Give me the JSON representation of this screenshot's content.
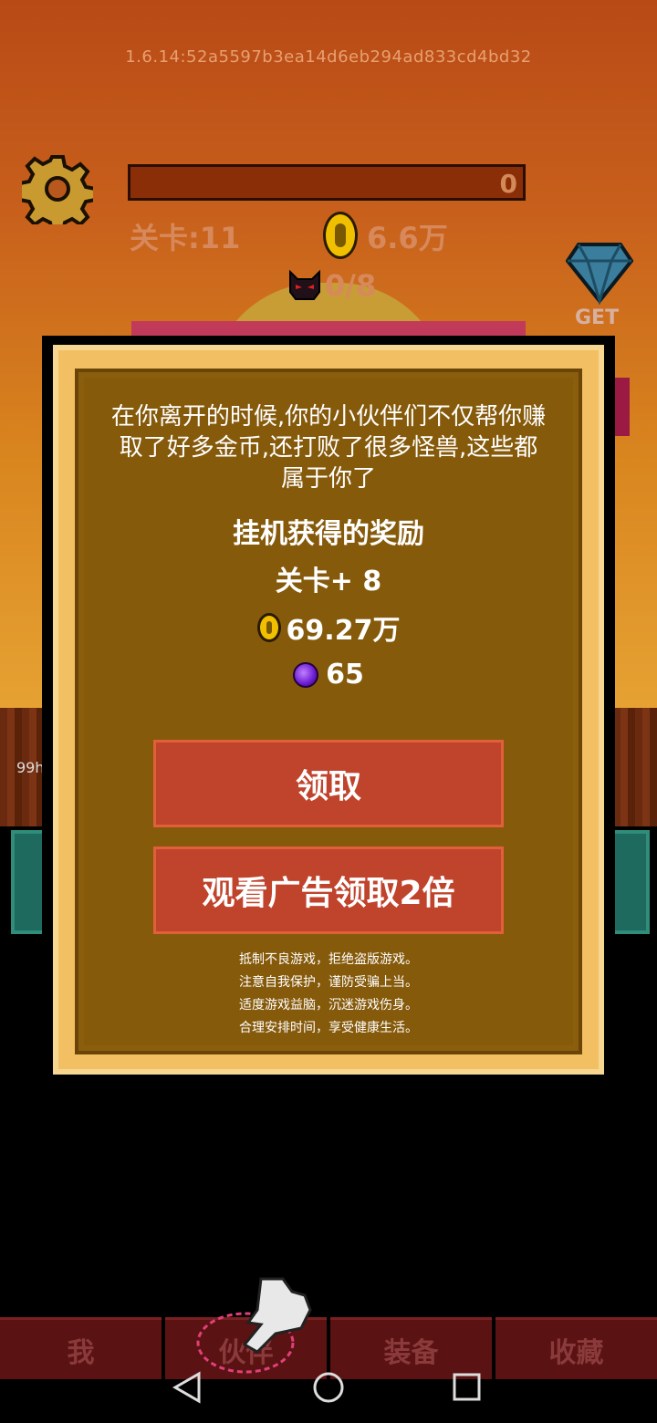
{
  "version": "1.6.14:52a5597b3ea14d6eb294ad833cd4bd32",
  "top_bar": {
    "progress_value": "0",
    "stage": "关卡:11",
    "gold": "6.6万",
    "kills": "0/8",
    "get_label": "GET"
  },
  "side_hp": "99h",
  "dialog": {
    "message": "在你离开的时候,你的小伙伴们不仅帮你赚取了好多金币,还打败了很多怪兽,这些都属于你了",
    "reward_title": "挂机获得的奖励",
    "stage_gain": "关卡+ 8",
    "gold_gain": "69.27万",
    "orb_gain": "65",
    "claim_label": "领取",
    "claim_double_label": "观看广告领取2倍",
    "notice": [
      "抵制不良游戏，拒绝盗版游戏。",
      "注意自我保护，谨防受骗上当。",
      "适度游戏益脑，沉迷游戏伤身。",
      "合理安排时间，享受健康生活。"
    ]
  },
  "tabs": [
    {
      "label": "我"
    },
    {
      "label": "伙伴"
    },
    {
      "label": "装备"
    },
    {
      "label": "收藏"
    }
  ],
  "colors": {
    "button": "#c0432c",
    "dialog_border": "#f2c062",
    "dialog_bg": "#8a5e0c"
  }
}
